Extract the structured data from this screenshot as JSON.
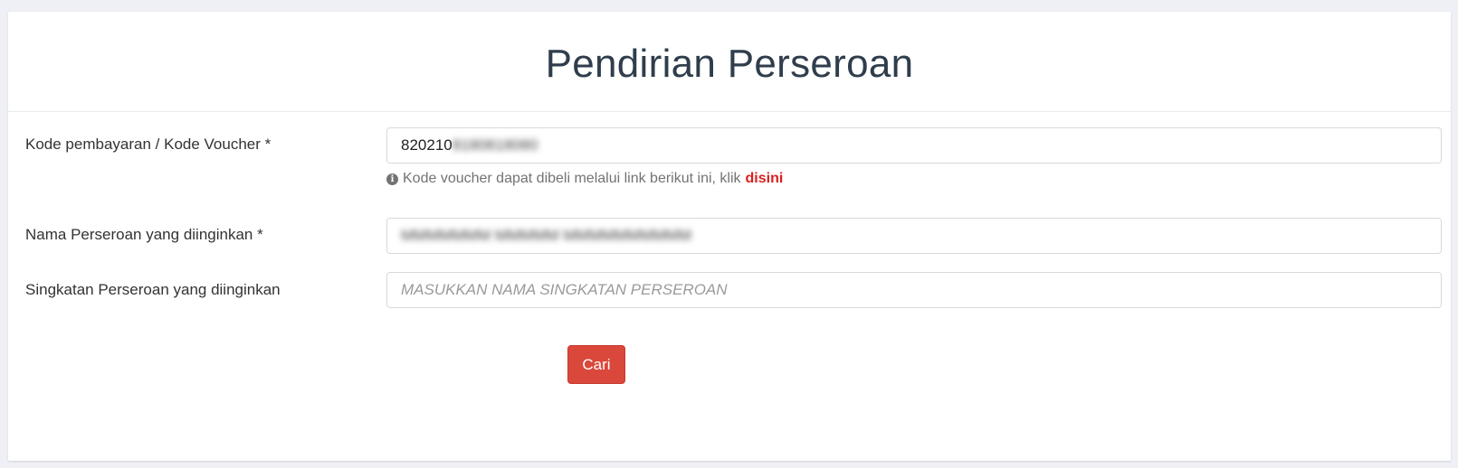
{
  "header": {
    "title": "Pendirian Perseroan"
  },
  "form": {
    "voucher": {
      "label": "Kode pembayaran / Kode Voucher *",
      "value_visible": "820210",
      "value_blurred": "8180818080",
      "help_text": "Kode voucher dapat dibeli melalui link berikut ini, klik",
      "help_link": "disini",
      "help_icon": "info-circle-icon"
    },
    "company_name": {
      "label": "Nama Perseroan yang diinginkan *",
      "value_blurred": "MMMMMMM MMMMM MMMMMMMMMM"
    },
    "abbreviation": {
      "label": "Singkatan Perseroan yang diinginkan",
      "placeholder": "MASUKKAN NAMA SINGKATAN PERSEROAN"
    },
    "submit": {
      "label": "Cari"
    }
  },
  "colors": {
    "background": "#eef0f5",
    "title": "#2f3d4c",
    "link": "#d91f1f",
    "button": "#d9483b"
  }
}
